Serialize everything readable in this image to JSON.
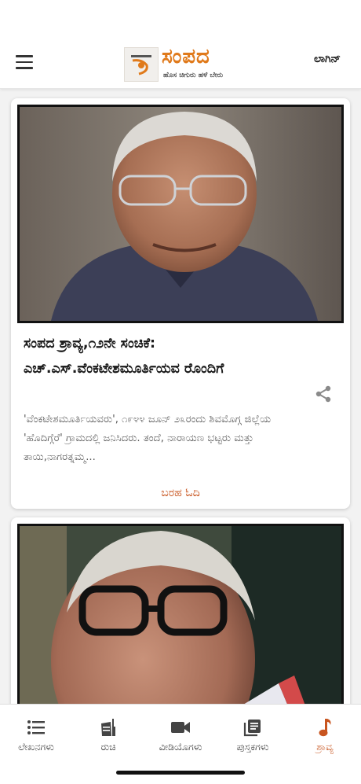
{
  "header": {
    "logo_title": "ಸಂಪದ",
    "logo_tagline": "ಹೊಸ ಚಿಗುರು ಹಳೆ ಬೇರು",
    "login_label": "ಲಾಗಿನ್"
  },
  "feed": {
    "items": [
      {
        "title": "ಸಂಪದ ಶ್ರಾವ್ಯ,೧೨ನೇ ಸಂಚಿಕೆ: ಎಚ್.ಎಸ್.ವೆಂಕಟೇಶಮೂರ್ತಿಯವ ರೊಂದಿಗೆ",
        "excerpt": "'ವೆಂಕಟೇಶಮೂರ್ತಿಯವರು', ೧೯೪೪ ಜೂನ್ ೨೩ರಂದು ಶಿವಮೊಗ್ಗ ಜಿಲ್ಲೆಯ 'ಹೊದಿಗ್ಗೆರೆ' ಗ್ರಾಮದಲ್ಲಿ ಜನಿಸಿದರು. ತಂದೆ, ನಾರಾಯಣ ಭಟ್ಟರು ಮತ್ತು ತಾಯಿ,ನಾಗರತ್ನಮ್ಮ...",
        "read_more": "ಬರಹ ಓದಿ"
      }
    ]
  },
  "bottom_nav": {
    "items": [
      {
        "label": "ಲೇಖನಗಳು",
        "icon": "list-icon"
      },
      {
        "label": "ರುಚಿ",
        "icon": "recipe-icon"
      },
      {
        "label": "ವೀಡಿಯೊಗಳು",
        "icon": "video-icon"
      },
      {
        "label": "ಪುಸ್ತಕಗಳು",
        "icon": "books-icon"
      },
      {
        "label": "ಶ್ರಾವ್ಯ",
        "icon": "music-note-icon"
      }
    ],
    "active_index": 4
  },
  "colors": {
    "accent": "#c8551f",
    "logo": "#e07a1b"
  }
}
